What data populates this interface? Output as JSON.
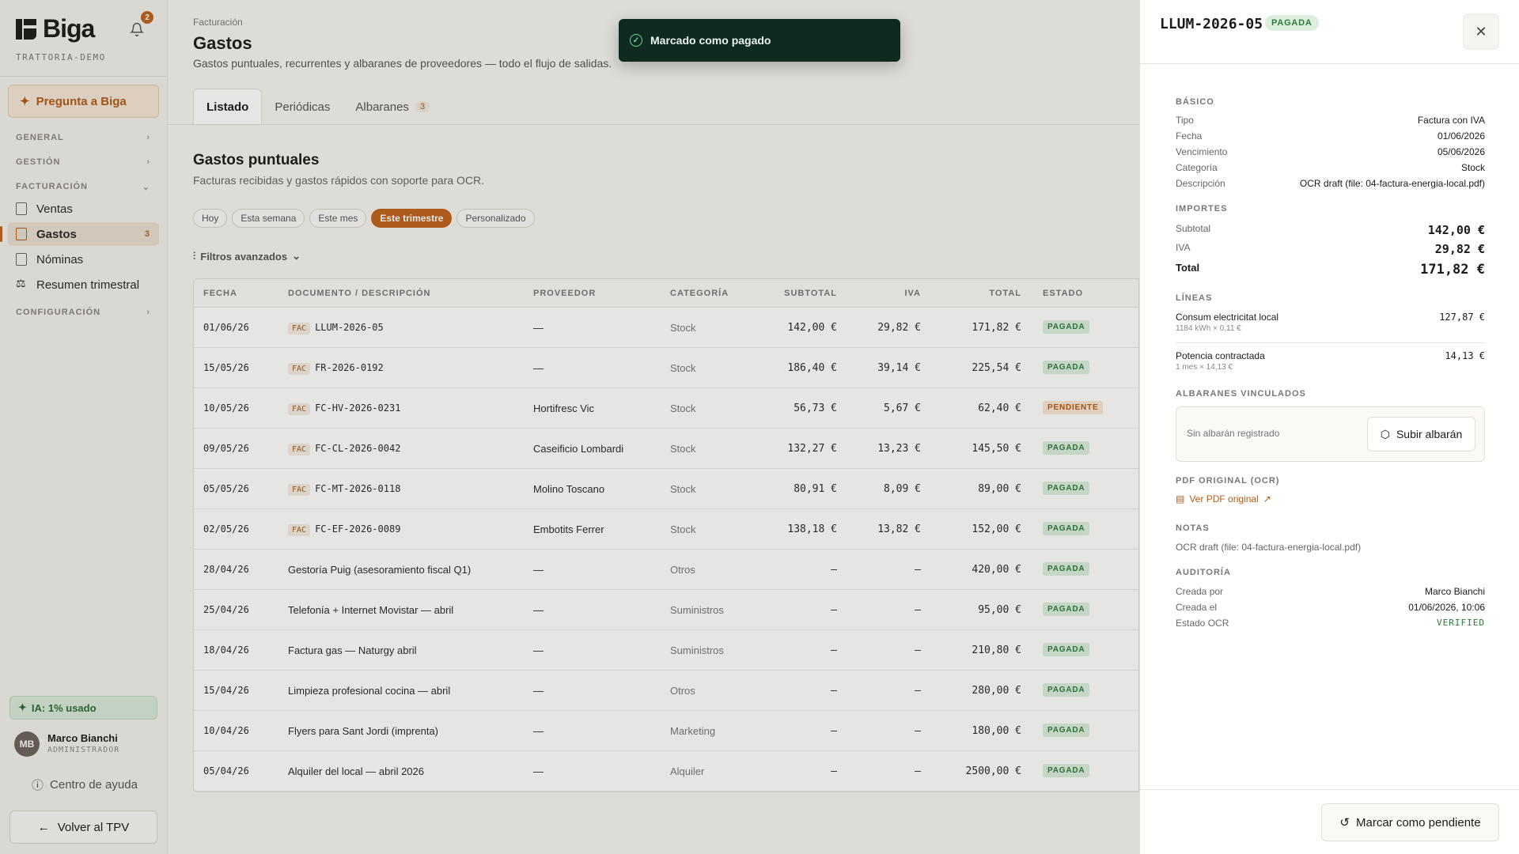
{
  "sidebar": {
    "brand": "Biga",
    "notifications": "2",
    "workspace": "TRATTORIA-DEMO",
    "ask": "Pregunta a Biga",
    "sections": {
      "general": "GENERAL",
      "gestion": "GESTIÓN",
      "facturacion": "FACTURACIÓN",
      "configuracion": "CONFIGURACIÓN"
    },
    "items": [
      {
        "label": "Ventas"
      },
      {
        "label": "Gastos",
        "count": "3"
      },
      {
        "label": "Nóminas"
      },
      {
        "label": "Resumen trimestral"
      }
    ],
    "ai_usage": "IA: 1% usado",
    "user": {
      "initials": "MB",
      "name": "Marco Bianchi",
      "role": "ADMINISTRADOR"
    },
    "help": "Centro de ayuda",
    "back": "Volver al TPV"
  },
  "page": {
    "breadcrumb": "Facturación",
    "title": "Gastos",
    "subtitle": "Gastos puntuales, recurrentes y albaranes de proveedores — todo el flujo de salidas.",
    "tabs": [
      {
        "label": "Listado"
      },
      {
        "label": "Periódicas"
      },
      {
        "label": "Albaranes",
        "count": "3"
      }
    ],
    "section_title": "Gastos puntuales",
    "section_subtitle": "Facturas recibidas y gastos rápidos con soporte para OCR.",
    "chips": [
      "Hoy",
      "Esta semana",
      "Este mes",
      "Este trimestre",
      "Personalizado"
    ],
    "advanced": "Filtros avanzados"
  },
  "table": {
    "headers": [
      "FECHA",
      "DOCUMENTO / DESCRIPCIÓN",
      "PROVEEDOR",
      "CATEGORÍA",
      "SUBTOTAL",
      "IVA",
      "TOTAL",
      "ESTADO"
    ],
    "fac_tag": "FAC",
    "rows": [
      {
        "fecha": "01/06/26",
        "doc": "LLUM-2026-05",
        "fac": true,
        "prov": "—",
        "cat": "Stock",
        "sub": "142,00 €",
        "iva": "29,82 €",
        "total": "171,82 €",
        "estado": "PAGADA"
      },
      {
        "fecha": "15/05/26",
        "doc": "FR-2026-0192",
        "fac": true,
        "prov": "—",
        "cat": "Stock",
        "sub": "186,40 €",
        "iva": "39,14 €",
        "total": "225,54 €",
        "estado": "PAGADA"
      },
      {
        "fecha": "10/05/26",
        "doc": "FC-HV-2026-0231",
        "fac": true,
        "prov": "Hortifresc Vic",
        "cat": "Stock",
        "sub": "56,73 €",
        "iva": "5,67 €",
        "total": "62,40 €",
        "estado": "PENDIENTE"
      },
      {
        "fecha": "09/05/26",
        "doc": "FC-CL-2026-0042",
        "fac": true,
        "prov": "Caseificio Lombardi",
        "cat": "Stock",
        "sub": "132,27 €",
        "iva": "13,23 €",
        "total": "145,50 €",
        "estado": "PAGADA"
      },
      {
        "fecha": "05/05/26",
        "doc": "FC-MT-2026-0118",
        "fac": true,
        "prov": "Molino Toscano",
        "cat": "Stock",
        "sub": "80,91 €",
        "iva": "8,09 €",
        "total": "89,00 €",
        "estado": "PAGADA"
      },
      {
        "fecha": "02/05/26",
        "doc": "FC-EF-2026-0089",
        "fac": true,
        "prov": "Embotits Ferrer",
        "cat": "Stock",
        "sub": "138,18 €",
        "iva": "13,82 €",
        "total": "152,00 €",
        "estado": "PAGADA"
      },
      {
        "fecha": "28/04/26",
        "doc": "Gestoría Puig (asesoramiento fiscal Q1)",
        "fac": false,
        "prov": "—",
        "cat": "Otros",
        "sub": "—",
        "iva": "—",
        "total": "420,00 €",
        "estado": "PAGADA"
      },
      {
        "fecha": "25/04/26",
        "doc": "Telefonía + Internet Movistar — abril",
        "fac": false,
        "prov": "—",
        "cat": "Suministros",
        "sub": "—",
        "iva": "—",
        "total": "95,00 €",
        "estado": "PAGADA"
      },
      {
        "fecha": "18/04/26",
        "doc": "Factura gas — Naturgy abril",
        "fac": false,
        "prov": "—",
        "cat": "Suministros",
        "sub": "—",
        "iva": "—",
        "total": "210,80 €",
        "estado": "PAGADA"
      },
      {
        "fecha": "15/04/26",
        "doc": "Limpieza profesional cocina — abril",
        "fac": false,
        "prov": "—",
        "cat": "Otros",
        "sub": "—",
        "iva": "—",
        "total": "280,00 €",
        "estado": "PAGADA"
      },
      {
        "fecha": "10/04/26",
        "doc": "Flyers para Sant Jordi (imprenta)",
        "fac": false,
        "prov": "—",
        "cat": "Marketing",
        "sub": "—",
        "iva": "—",
        "total": "180,00 €",
        "estado": "PAGADA"
      },
      {
        "fecha": "05/04/26",
        "doc": "Alquiler del local — abril 2026",
        "fac": false,
        "prov": "—",
        "cat": "Alquiler",
        "sub": "—",
        "iva": "—",
        "total": "2500,00 €",
        "estado": "PAGADA"
      }
    ]
  },
  "toast": {
    "message": "Marcado como pagado"
  },
  "drawer": {
    "code": "LLUM-2026-05",
    "status": "PAGADA",
    "basico": {
      "title": "BÁSICO",
      "rows": [
        {
          "k": "Tipo",
          "v": "Factura con IVA"
        },
        {
          "k": "Fecha",
          "v": "01/06/2026"
        },
        {
          "k": "Vencimiento",
          "v": "05/06/2026"
        },
        {
          "k": "Categoría",
          "v": "Stock"
        },
        {
          "k": "Descripción",
          "v": "OCR draft (file: 04-factura-energia-local.pdf)"
        }
      ]
    },
    "importes": {
      "title": "IMPORTES",
      "subtotal_k": "Subtotal",
      "subtotal_v": "142,00 €",
      "iva_k": "IVA",
      "iva_v": "29,82 €",
      "total_k": "Total",
      "total_v": "171,82 €"
    },
    "lineas": {
      "title": "LÍNEAS",
      "items": [
        {
          "name": "Consum electricitat local",
          "sub": "1184 kWh × 0,11 €",
          "amount": "127,87 €"
        },
        {
          "name": "Potencia contractada",
          "sub": "1 mes × 14,13 €",
          "amount": "14,13 €"
        }
      ]
    },
    "albaranes": {
      "title": "ALBARANES VINCULADOS",
      "empty": "Sin albarán registrado",
      "button": "Subir albarán"
    },
    "pdf": {
      "title": "PDF ORIGINAL (OCR)",
      "link": "Ver PDF original"
    },
    "notas": {
      "title": "NOTAS",
      "text": "OCR draft (file: 04-factura-energia-local.pdf)"
    },
    "auditoria": {
      "title": "AUDITORÍA",
      "rows": [
        {
          "k": "Creada por",
          "v": "Marco Bianchi"
        },
        {
          "k": "Creada el",
          "v": "01/06/2026, 10:06"
        },
        {
          "k": "Estado OCR",
          "v": "VERIFIED"
        }
      ]
    },
    "footer_button": "Marcar como pendiente"
  }
}
